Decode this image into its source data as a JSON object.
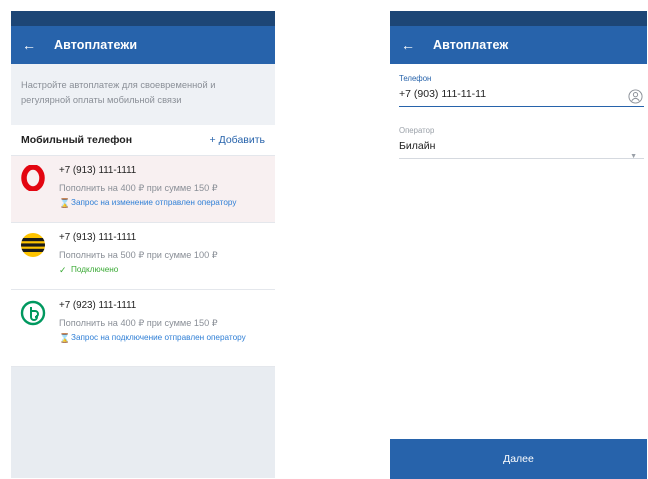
{
  "left": {
    "title": "Автоплатежи",
    "intro": "Настройте автоплатеж для своевременной и регулярной оплаты мобильной связи",
    "section_title": "Мобильный телефон",
    "add_label": "+ Добавить",
    "items": [
      {
        "operator_icon": "mts-logo-icon",
        "phone": "+7 (913) 111-1111",
        "desc": "Пополнить на 400 ₽ при сумме 150 ₽",
        "status": "Запрос на изменение отправлен оператору",
        "status_color": "#2f7fd6",
        "status_icon": "spinner-icon"
      },
      {
        "operator_icon": "beeline-logo-icon",
        "phone": "+7 (913) 111-1111",
        "desc": "Пополнить на 500 ₽ при сумме 100 ₽",
        "status": "Подключено",
        "status_color": "#3aaa35",
        "status_icon": "check-icon"
      },
      {
        "operator_icon": "megafon-logo-icon",
        "phone": "+7 (923) 111-1111",
        "desc": "Пополнить на 400 ₽ при сумме 150 ₽",
        "status": "Запрос на подключение отправлен оператору",
        "status_color": "#2f7fd6",
        "status_icon": "spinner-icon"
      }
    ]
  },
  "right": {
    "title": "Автоплатеж",
    "phone_label": "Телефон",
    "phone_value": "+7 (903) 111-11-11",
    "operator_label": "Оператор",
    "operator_value": "Билайн",
    "next_label": "Далее"
  },
  "colors": {
    "appbar": "#2763ab",
    "statusbar": "#1d4676",
    "accent_blue": "#2f7fd6",
    "success_green": "#3aaa35"
  }
}
